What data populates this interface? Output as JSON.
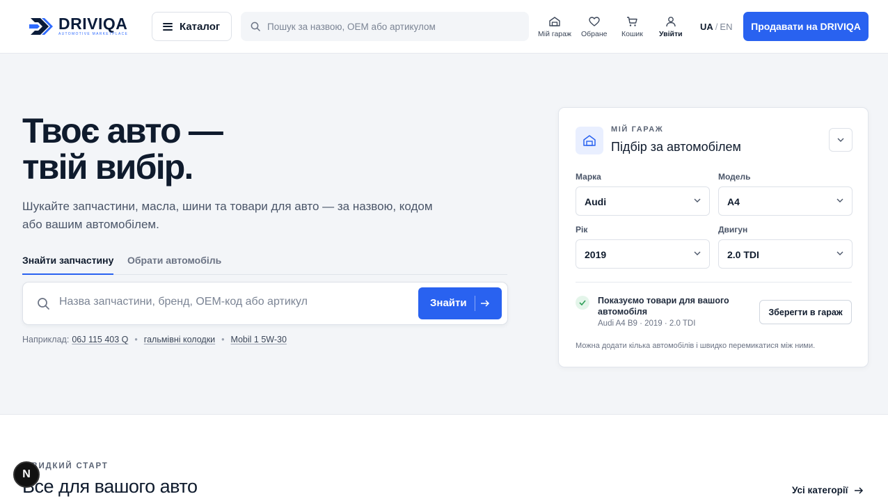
{
  "header": {
    "logo_name": "DRIVIQA",
    "logo_tagline": "AUTOMOTIVE MARKETPLACE",
    "catalog_label": "Каталог",
    "search_placeholder": "Пошук за назвою, OEM або артикулом",
    "nav": {
      "garage": "Мій гараж",
      "favorites": "Обране",
      "cart": "Кошик",
      "login": "Увійти"
    },
    "lang_active": "UA",
    "lang_sep": "/",
    "lang_other": "EN",
    "sell_label": "Продавати на DRIVIQA"
  },
  "hero": {
    "title_line1": "Твоє авто —",
    "title_line2": "твій вибір.",
    "subtitle": "Шукайте запчастини, масла, шини та товари для авто — за назвою, кодом або вашим автомобілем.",
    "tabs": [
      "Знайти запчастину",
      "Обрати автомобіль"
    ],
    "search_placeholder": "Назва запчастини, бренд, OEM-код або артикул",
    "find_label": "Знайти",
    "examples_label": "Наприклад:",
    "examples": [
      "06J 115 403 Q",
      "гальмівні колодки",
      "Mobil 1 5W-30"
    ],
    "example_sep": "•"
  },
  "garage_card": {
    "kicker": "МІЙ ГАРАЖ",
    "title": "Підбір за автомобілем",
    "fields": {
      "make_label": "Марка",
      "make_value": "Audi",
      "model_label": "Модель",
      "model_value": "A4",
      "year_label": "Рік",
      "year_value": "2019",
      "engine_label": "Двигун",
      "engine_value": "2.0 TDI"
    },
    "status_text": "Показуємо товари для вашого автомобіля",
    "car_summary": "Audi A4 B9 · 2019 · 2.0 TDI",
    "save_label": "Зберегти в гараж",
    "note": "Можна додати кілька автомобілів і швидко перемикатися між ними."
  },
  "lower": {
    "kicker": "ШВИДКИЙ СТАРТ",
    "title": "Все для вашого авто",
    "all_categories": "Усі категорії"
  },
  "badge": "N",
  "colors": {
    "accent": "#2962f0",
    "text": "#0f1b2d",
    "background": "#f3f5f8"
  }
}
